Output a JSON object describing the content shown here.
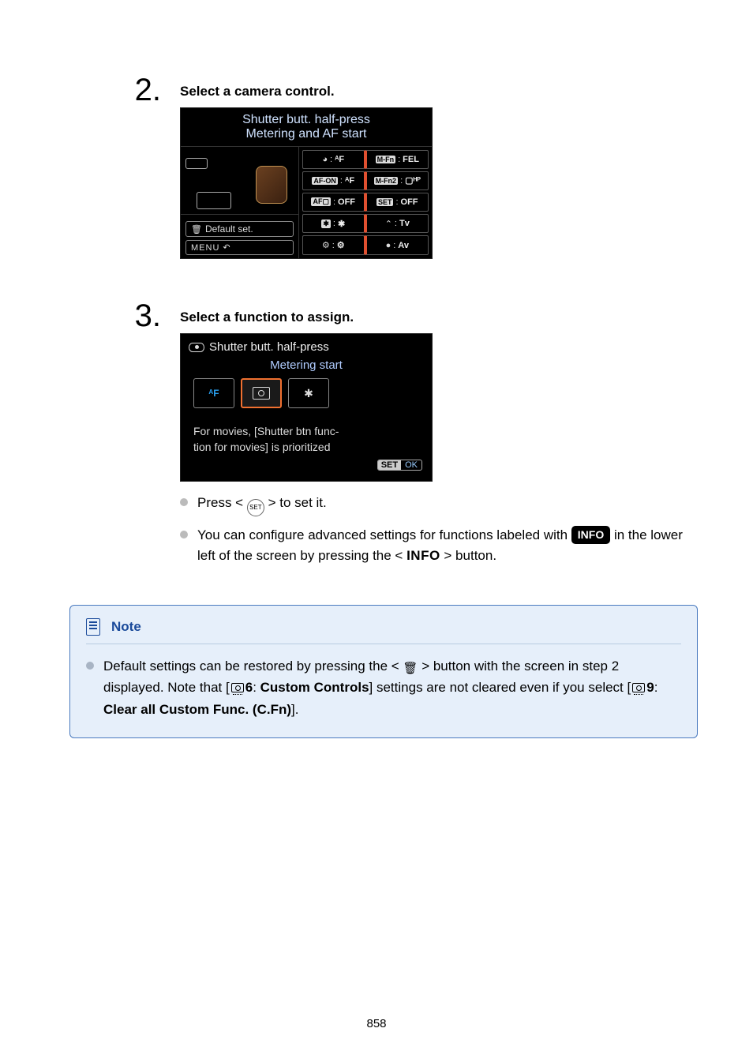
{
  "steps": [
    {
      "num": "2.",
      "title": "Select a camera control.",
      "screenshot1": {
        "title": "Shutter butt. half-press",
        "subtitle": "Metering and AF start",
        "defaultSet": "Default set.",
        "menu": "MENU",
        "cells": {
          "r1c1_tag": "",
          "r1c1_val": "ᴬF",
          "r1c2_tag": "M-Fn",
          "r1c2_val": "FEL",
          "r2c1_tag": "AF-ON",
          "r2c1_val": "ᴬF",
          "r2c2_tag": "M-Fn2",
          "r2c2_val": "▢ᴴᴾ",
          "r3c1_tag": "AF▢",
          "r3c1_val": "OFF",
          "r3c2_tag": "SET",
          "r3c2_val": "OFF",
          "r4c1_tag": "✱",
          "r4c1_val": "✱",
          "r4c2_tag": "⌃",
          "r4c2_val": "Tv",
          "r5c1_tag": "⚙",
          "r5c1_val": "⚙",
          "r5c2_tag": "●",
          "r5c2_val": "Av"
        }
      }
    },
    {
      "num": "3.",
      "title": "Select a function to assign.",
      "screenshot2": {
        "head": "Shutter butt. half-press",
        "sub": "Metering start",
        "opt_af": "ᴬF",
        "opt_star": "✱",
        "note_l1": "For movies, [Shutter btn func-",
        "note_l2": "tion for movies] is prioritized",
        "set": "SET",
        "ok": "OK"
      },
      "bullets": [
        {
          "pre": "Press < ",
          "set": "SET",
          "post": " > to set it."
        },
        {
          "pre": "You can configure advanced settings for functions labeled with ",
          "info": "INFO",
          "mid": " in the lower left of the screen by pressing the < ",
          "infoBtn": "INFO",
          "post": " > button."
        }
      ]
    }
  ],
  "note": {
    "head": "Note",
    "text_pre": "Default settings can be restored by pressing the < ",
    "text_trash": "🗑",
    "text_a": " > button with the screen in step 2 displayed. Note that [",
    "menu6": "6",
    "custom_controls": "Custom Controls",
    "text_b": "] settings are not cleared even if you select [",
    "menu9": "9",
    "clear_all": "Clear all Custom Func. (C.Fn)",
    "text_c": "]."
  },
  "pageNumber": "858"
}
